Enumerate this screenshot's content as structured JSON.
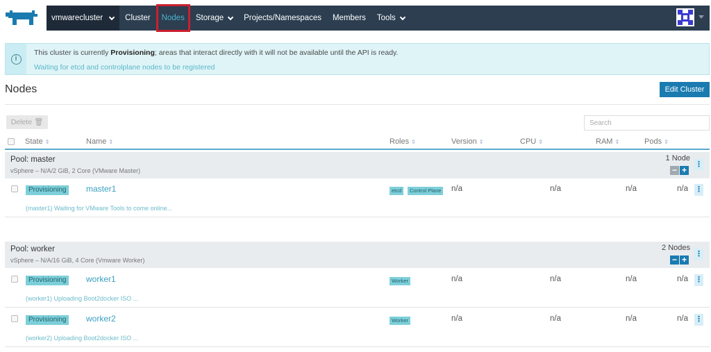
{
  "nav": {
    "cluster": "vmwarecluster",
    "items": [
      "Cluster",
      "Nodes",
      "Storage",
      "Projects/Namespaces",
      "Members",
      "Tools"
    ],
    "active": "Nodes"
  },
  "banner": {
    "prefix": "This cluster is currently ",
    "state": "Provisioning",
    "suffix": "; areas that interact directly with it will not be available until the API is ready.",
    "detail": "Waiting for etcd and controlplane nodes to be registered"
  },
  "page": {
    "title": "Nodes",
    "edit_button": "Edit Cluster",
    "delete_button": "Delete",
    "search_placeholder": "Search"
  },
  "columns": [
    "State",
    "Name",
    "Roles",
    "Version",
    "CPU",
    "RAM",
    "Pods"
  ],
  "pools": [
    {
      "title": "Pool: master",
      "subtitle": "vSphere – N/A/2 GiB, 2 Core (VMware Master)",
      "count": "1 Node",
      "nodes": [
        {
          "state": "Provisioning",
          "name": "master1",
          "roles": [
            "etcd",
            "Control Plane"
          ],
          "version": "n/a",
          "cpu": "n/a",
          "ram": "n/a",
          "pods": "n/a",
          "message": "(master1) Waiting for VMware Tools to come online..."
        }
      ]
    },
    {
      "title": "Pool: worker",
      "subtitle": "vSphere – N/A/16 GiB, 4 Core (Vmware Worker)",
      "count": "2 Nodes",
      "nodes": [
        {
          "state": "Provisioning",
          "name": "worker1",
          "roles": [
            "Worker"
          ],
          "version": "n/a",
          "cpu": "n/a",
          "ram": "n/a",
          "pods": "n/a",
          "message": "(worker1) Uploading Boot2docker ISO ..."
        },
        {
          "state": "Provisioning",
          "name": "worker2",
          "roles": [
            "Worker"
          ],
          "version": "n/a",
          "cpu": "n/a",
          "ram": "n/a",
          "pods": "n/a",
          "message": "(worker2) Uploading Boot2docker ISO ..."
        }
      ]
    }
  ],
  "colors": {
    "nav_bg": "#2c3e50",
    "accent": "#1a7bb0",
    "badge": "#7dcfd9",
    "highlight_box": "#cc1f2e"
  }
}
